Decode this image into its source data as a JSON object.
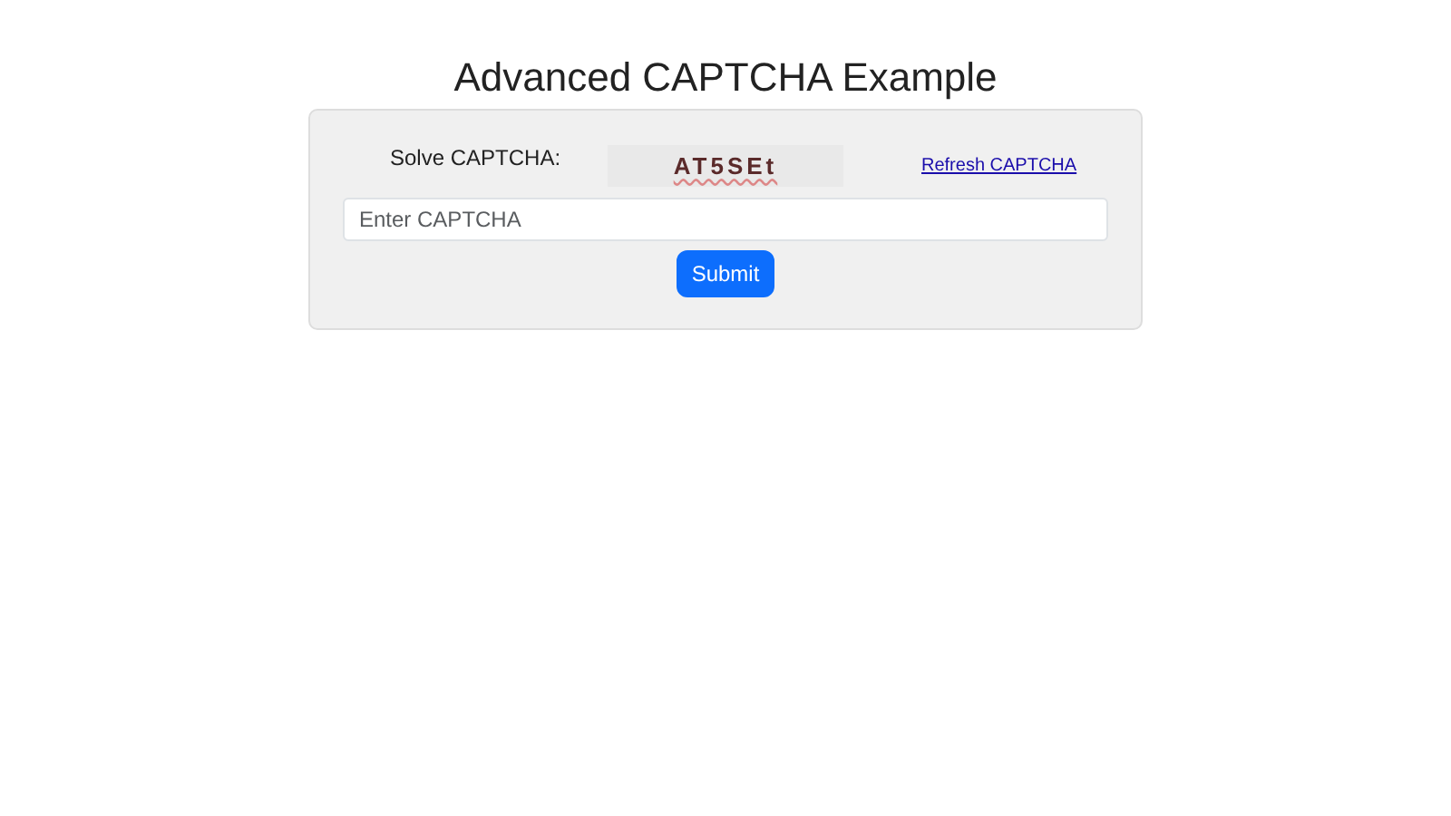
{
  "title": "Advanced CAPTCHA Example",
  "form": {
    "label": "Solve CAPTCHA:",
    "captcha": "AT5SEt",
    "refresh_link": "Refresh CAPTCHA",
    "input": {
      "placeholder": "Enter CAPTCHA"
    },
    "submit": "Submit"
  }
}
